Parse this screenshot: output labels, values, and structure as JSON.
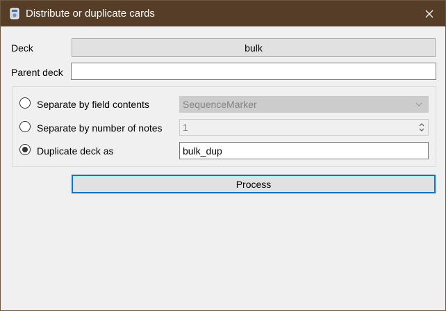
{
  "window": {
    "title": "Distribute or duplicate cards"
  },
  "deck": {
    "label": "Deck",
    "value": "bulk"
  },
  "parent_deck": {
    "label": "Parent deck",
    "value": ""
  },
  "options": {
    "separate_by_field": {
      "label": "Separate by field contents",
      "selected": false,
      "field_value": "SequenceMarker"
    },
    "separate_by_number": {
      "label": "Separate by number of notes",
      "selected": false,
      "number_value": "1"
    },
    "duplicate_deck": {
      "label": "Duplicate deck as",
      "selected": true,
      "name_value": "bulk_dup"
    }
  },
  "actions": {
    "process_label": "Process"
  },
  "colors": {
    "titlebar": "#553d27",
    "window_bg": "#f0f0f0",
    "focus_border": "#0078d7"
  }
}
